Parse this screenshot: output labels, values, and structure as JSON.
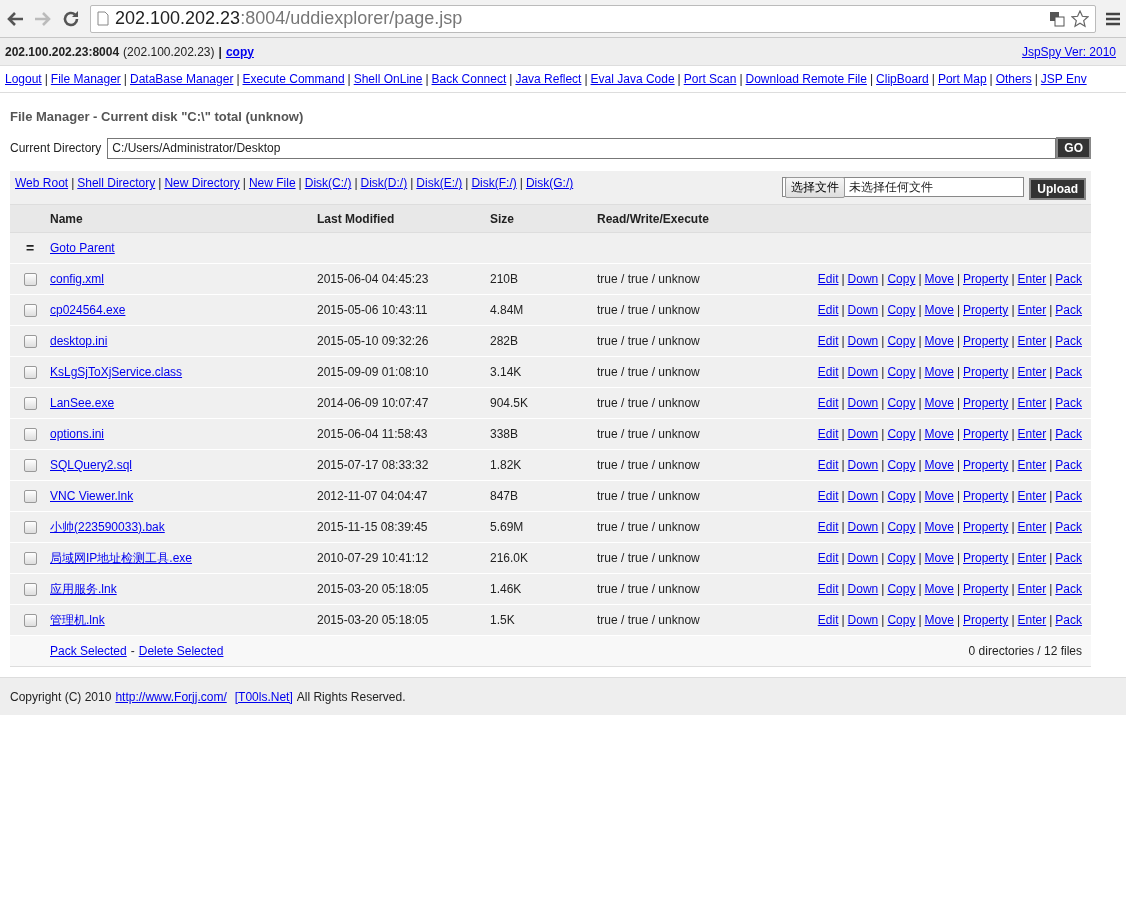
{
  "browser": {
    "back_disabled": false,
    "forward_disabled": true,
    "address_host": "202.100.202.23",
    "address_rest": ":8004/uddiexplorer/page.jsp"
  },
  "info_bar": {
    "host": "202.100.202.23:8004",
    "ip": "(202.100.202.23)",
    "separator": "|",
    "copy_link": "copy",
    "version_link": "JspSpy Ver: 2010"
  },
  "nav": {
    "separator": "|",
    "links": [
      "Logout",
      "File Manager",
      "DataBase Manager",
      "Execute Command",
      "Shell OnLine",
      "Back Connect",
      "Java Reflect",
      "Eval Java Code",
      "Port Scan",
      "Download Remote File",
      "ClipBoard",
      "Port Map",
      "Others",
      "JSP Env"
    ]
  },
  "title": "File Manager - Current disk \"C:\\\" total (unknow)",
  "directory": {
    "label": "Current Directory",
    "value": "C:/Users/Administrator/Desktop",
    "button": "GO"
  },
  "toolbar": {
    "separator": "|",
    "links": [
      "Web Root",
      "Shell Directory",
      "New Directory",
      "New File",
      "Disk(C:/)",
      "Disk(D:/)",
      "Disk(E:/)",
      "Disk(F:/)",
      "Disk(G:/)"
    ],
    "choose_button": "选择文件",
    "no_file": "未选择任何文件",
    "upload_button": "Upload"
  },
  "table": {
    "columns": [
      "Name",
      "Last Modified",
      "Size",
      "Read/Write/Execute"
    ],
    "parent_row": {
      "icon": "=",
      "link": "Goto Parent"
    },
    "action_separator": "|",
    "rows": [
      {
        "name": "config.xml",
        "modified": "2015-06-04 04:45:23",
        "size": "210B",
        "rwx": "true / true / unknow",
        "checked": false,
        "actions": [
          "Edit",
          "Down",
          "Copy",
          "Move",
          "Property",
          "Enter",
          "Pack"
        ]
      },
      {
        "name": "cp024564.exe",
        "modified": "2015-05-06 10:43:11",
        "size": "4.84M",
        "rwx": "true / true / unknow",
        "checked": false,
        "actions": [
          "Edit",
          "Down",
          "Copy",
          "Move",
          "Property",
          "Enter",
          "Pack"
        ]
      },
      {
        "name": "desktop.ini",
        "modified": "2015-05-10 09:32:26",
        "size": "282B",
        "rwx": "true / true / unknow",
        "checked": false,
        "actions": [
          "Edit",
          "Down",
          "Copy",
          "Move",
          "Property",
          "Enter",
          "Pack"
        ]
      },
      {
        "name": "KsLgSjToXjService.class",
        "modified": "2015-09-09 01:08:10",
        "size": "3.14K",
        "rwx": "true / true / unknow",
        "checked": false,
        "actions": [
          "Edit",
          "Down",
          "Copy",
          "Move",
          "Property",
          "Enter",
          "Pack"
        ]
      },
      {
        "name": "LanSee.exe",
        "modified": "2014-06-09 10:07:47",
        "size": "904.5K",
        "rwx": "true / true / unknow",
        "checked": false,
        "actions": [
          "Edit",
          "Down",
          "Copy",
          "Move",
          "Property",
          "Enter",
          "Pack"
        ]
      },
      {
        "name": "options.ini",
        "modified": "2015-06-04 11:58:43",
        "size": "338B",
        "rwx": "true / true / unknow",
        "checked": false,
        "actions": [
          "Edit",
          "Down",
          "Copy",
          "Move",
          "Property",
          "Enter",
          "Pack"
        ]
      },
      {
        "name": "SQLQuery2.sql",
        "modified": "2015-07-17 08:33:32",
        "size": "1.82K",
        "rwx": "true / true / unknow",
        "checked": false,
        "actions": [
          "Edit",
          "Down",
          "Copy",
          "Move",
          "Property",
          "Enter",
          "Pack"
        ]
      },
      {
        "name": "VNC Viewer.lnk",
        "modified": "2012-11-07 04:04:47",
        "size": "847B",
        "rwx": "true / true / unknow",
        "checked": false,
        "actions": [
          "Edit",
          "Down",
          "Copy",
          "Move",
          "Property",
          "Enter",
          "Pack"
        ]
      },
      {
        "name": "小帅(223590033).bak",
        "modified": "2015-11-15 08:39:45",
        "size": "5.69M",
        "rwx": "true / true / unknow",
        "checked": false,
        "actions": [
          "Edit",
          "Down",
          "Copy",
          "Move",
          "Property",
          "Enter",
          "Pack"
        ]
      },
      {
        "name": "局域网IP地址检测工具.exe",
        "modified": "2010-07-29 10:41:12",
        "size": "216.0K",
        "rwx": "true / true / unknow",
        "checked": false,
        "actions": [
          "Edit",
          "Down",
          "Copy",
          "Move",
          "Property",
          "Enter",
          "Pack"
        ]
      },
      {
        "name": "应用服务.lnk",
        "modified": "2015-03-20 05:18:05",
        "size": "1.46K",
        "rwx": "true / true / unknow",
        "checked": false,
        "actions": [
          "Edit",
          "Down",
          "Copy",
          "Move",
          "Property",
          "Enter",
          "Pack"
        ]
      },
      {
        "name": "管理机.lnk",
        "modified": "2015-03-20 05:18:05",
        "size": "1.5K",
        "rwx": "true / true / unknow",
        "checked": false,
        "actions": [
          "Edit",
          "Down",
          "Copy",
          "Move",
          "Property",
          "Enter",
          "Pack"
        ]
      }
    ],
    "footer": {
      "pack_link": "Pack Selected",
      "dash": "-",
      "delete_link": "Delete Selected",
      "summary": "0 directories / 12 files"
    }
  },
  "footer": {
    "prefix": "Copyright (C) 2010",
    "site_link": "http://www.Forjj.com/",
    "tools_link": "[T00ls.Net]",
    "suffix": "All Rights Reserved."
  }
}
